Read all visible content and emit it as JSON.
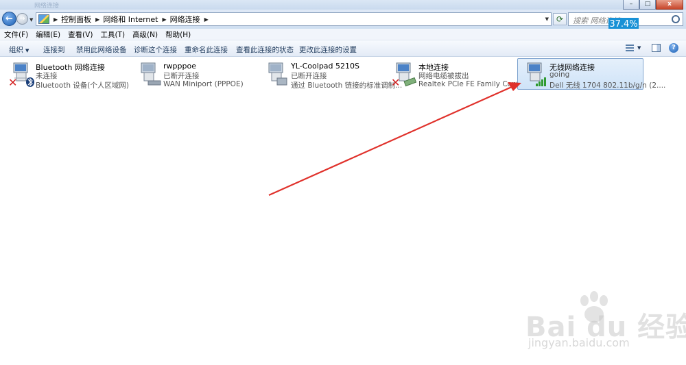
{
  "window": {
    "title_faded": "网络连接",
    "title_faded_right": "",
    "controls": {
      "minimize": "–",
      "maximize": "□",
      "close": "x"
    }
  },
  "address_bar": {
    "crumbs": [
      "控制面板",
      "网络和 Internet",
      "网络连接"
    ],
    "search_placeholder": "搜索 网络连接"
  },
  "overlay": {
    "percent": "37.4%"
  },
  "menu": [
    "文件(F)",
    "编辑(E)",
    "查看(V)",
    "工具(T)",
    "高级(N)",
    "帮助(H)"
  ],
  "commands": {
    "organize": "组织",
    "connect_to": "连接到",
    "disable": "禁用此网络设备",
    "diagnose": "诊断这个连接",
    "rename": "重命名此连接",
    "view_status": "查看此连接的状态",
    "change_settings": "更改此连接的设置"
  },
  "connections": [
    {
      "name": "Bluetooth 网络连接",
      "status": "未连接",
      "device": "Bluetooth 设备(个人区域网)",
      "overlay": "x",
      "selected": false
    },
    {
      "name": "rwpppoe",
      "status": "已断开连接",
      "device": "WAN Miniport (PPPOE)",
      "overlay": "none",
      "selected": false
    },
    {
      "name": "YL-Coolpad 5210S",
      "status": "已断开连接",
      "device": "通过 Bluetooth 链接的标准调制...",
      "overlay": "none",
      "selected": false
    },
    {
      "name": "本地连接",
      "status": "网络电缆被拔出",
      "device": "Realtek PCIe FE Family Control...",
      "overlay": "x",
      "selected": false
    },
    {
      "name": "无线网络连接",
      "status": "going",
      "device": "Dell 无线 1704 802.11b/g/n (2....",
      "overlay": "signal",
      "selected": true
    }
  ],
  "watermark": {
    "main": "Bai du 经验",
    "sub": "jingyan.baidu.com"
  },
  "colors": {
    "arrow": "#e0312b",
    "selection": "#cfe3f8",
    "command_text": "#1e395b"
  }
}
